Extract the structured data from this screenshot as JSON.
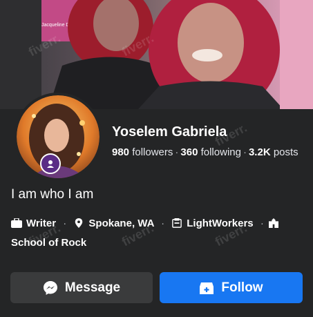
{
  "cover": {
    "poster_text": "Jacqueline Douglas"
  },
  "profile": {
    "name": "Yoselem Gabriela",
    "followers_count": "980",
    "followers_label": "followers",
    "following_count": "360",
    "following_label": "following",
    "posts_count": "3.2K",
    "posts_label": "posts",
    "bio": "I am who I am"
  },
  "details": [
    {
      "icon": "briefcase-icon",
      "label": "Writer"
    },
    {
      "icon": "location-pin-icon",
      "label": "Spokane, WA"
    },
    {
      "icon": "page-icon",
      "label": "LightWorkers"
    },
    {
      "icon": "school-icon",
      "label": "School of Rock"
    }
  ],
  "actions": {
    "message_label": "Message",
    "follow_label": "Follow"
  },
  "watermark_text": "fiverr.",
  "colors": {
    "background": "#242526",
    "follow_button": "#1877f2",
    "message_button": "#3a3b3c",
    "avatar_badge": "#5b2d86"
  }
}
